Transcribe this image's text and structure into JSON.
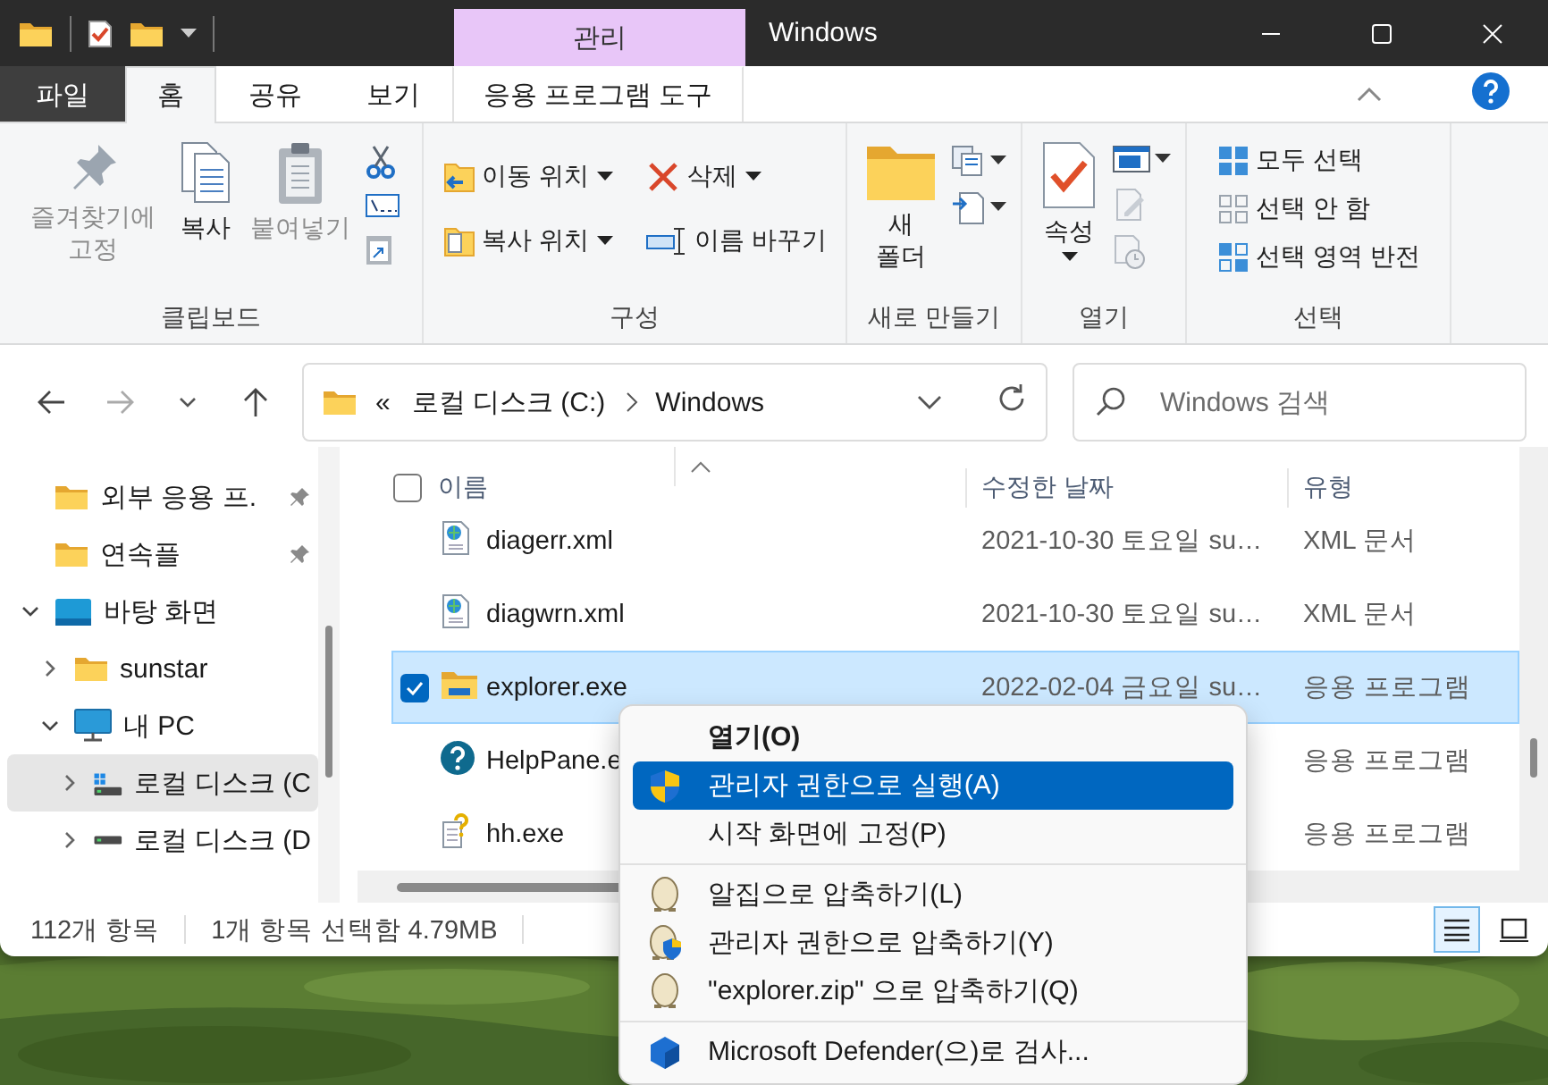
{
  "title_bar": {
    "context_tab": "관리",
    "title": "Windows"
  },
  "ribbon_tabs": [
    {
      "label": "파일",
      "kind": "file",
      "selected": false
    },
    {
      "label": "홈",
      "kind": "normal",
      "selected": true
    },
    {
      "label": "공유",
      "kind": "normal",
      "selected": false
    },
    {
      "label": "보기",
      "kind": "normal",
      "selected": false
    },
    {
      "label": "응용 프로그램 도구",
      "kind": "context",
      "selected": false
    }
  ],
  "ribbon_groups": [
    {
      "label": "클립보드",
      "items": [
        {
          "label": "즐겨찾기에 고정",
          "kind": "large",
          "disabled": true
        },
        {
          "label": "복사",
          "kind": "large",
          "disabled": false
        },
        {
          "label": "붙여넣기",
          "kind": "large",
          "disabled": true
        }
      ]
    },
    {
      "label": "구성",
      "items": [
        {
          "label": "이동 위치",
          "kind": "small",
          "dropdown": true,
          "disabled": false
        },
        {
          "label": "복사 위치",
          "kind": "small",
          "dropdown": true,
          "disabled": false
        },
        {
          "label": "삭제",
          "kind": "small",
          "dropdown": true,
          "disabled": false
        },
        {
          "label": "이름 바꾸기",
          "kind": "small",
          "dropdown": false,
          "disabled": false
        }
      ]
    },
    {
      "label": "새로 만들기",
      "items": [
        {
          "label": "새 폴더",
          "kind": "large",
          "disabled": false
        }
      ]
    },
    {
      "label": "열기",
      "items": [
        {
          "label": "속성",
          "kind": "large",
          "dropdown": true,
          "disabled": false
        }
      ]
    },
    {
      "label": "선택",
      "items": [
        {
          "label": "모두 선택",
          "kind": "small",
          "disabled": false
        },
        {
          "label": "선택 안 함",
          "kind": "small",
          "disabled": false
        },
        {
          "label": "선택 영역 반전",
          "kind": "small",
          "disabled": false
        }
      ]
    }
  ],
  "address_bar": {
    "overflow": "«",
    "path": [
      "로컬 디스크 (C:)",
      "Windows"
    ]
  },
  "search": {
    "placeholder": "Windows 검색"
  },
  "nav_pane": {
    "items": [
      {
        "label": "외부 응용 프.",
        "kind": "folder",
        "pinned": true,
        "selected": false
      },
      {
        "label": "연속플",
        "kind": "folder",
        "pinned": true,
        "selected": false
      },
      {
        "label": "바탕 화면",
        "kind": "desktop",
        "expanded": true,
        "selected": false,
        "children": [
          {
            "label": "sunstar",
            "kind": "folder",
            "expanded": false,
            "selected": false
          },
          {
            "label": "내 PC",
            "kind": "pc",
            "expanded": true,
            "selected": false,
            "children": [
              {
                "label": "로컬 디스크 (C",
                "kind": "system-drive",
                "expanded": false,
                "selected": true
              },
              {
                "label": "로컬 디스크 (D",
                "kind": "drive",
                "expanded": false,
                "selected": false
              }
            ]
          }
        ]
      }
    ]
  },
  "file_list": {
    "select_all": {
      "checked": false
    },
    "columns": [
      "이름",
      "수정한 날짜",
      "유형"
    ],
    "rows": [
      {
        "name": "diagerr.xml",
        "kind": "xml",
        "date": "2021-10-30 토요일 su…",
        "type": "XML 문서",
        "selected": false,
        "checked": false
      },
      {
        "name": "diagwrn.xml",
        "kind": "xml",
        "date": "2021-10-30 토요일 su…",
        "type": "XML 문서",
        "selected": false,
        "checked": false
      },
      {
        "name": "explorer.exe",
        "kind": "app",
        "date": "2022-02-04 금요일 su…",
        "type": "응용 프로그램",
        "selected": true,
        "checked": true
      },
      {
        "name": "HelpPane.e",
        "kind": "help",
        "type": "응용 프로그램",
        "selected": false,
        "checked": false
      },
      {
        "name": "hh.exe",
        "kind": "helpfile",
        "type": "응용 프로그램",
        "selected": false,
        "checked": false
      }
    ]
  },
  "status_bar": {
    "item_count": "112개 항목",
    "selection": "1개 항목 선택함 4.79MB",
    "views": [
      {
        "kind": "details",
        "selected": true
      },
      {
        "kind": "tiles",
        "selected": false
      }
    ]
  },
  "context_menu": {
    "items": [
      {
        "label": "열기(O)",
        "kind": "plain",
        "default": true,
        "selected": false
      },
      {
        "label": "관리자 권한으로 실행(A)",
        "kind": "shield",
        "default": false,
        "selected": true
      },
      {
        "label": "시작 화면에 고정(P)",
        "kind": "plain",
        "default": false,
        "selected": false
      },
      {
        "kind": "separator"
      },
      {
        "label": "알집으로 압축하기(L)",
        "kind": "egg",
        "default": false,
        "selected": false
      },
      {
        "label": "관리자 권한으로 압축하기(Y)",
        "kind": "egg-shield",
        "default": false,
        "selected": false
      },
      {
        "label": "\"explorer.zip\" 으로 압축하기(Q)",
        "kind": "egg",
        "default": false,
        "selected": false
      },
      {
        "kind": "separator"
      },
      {
        "label": "Microsoft Defender(으)로 검사...",
        "kind": "defender",
        "default": false,
        "selected": false
      }
    ]
  }
}
